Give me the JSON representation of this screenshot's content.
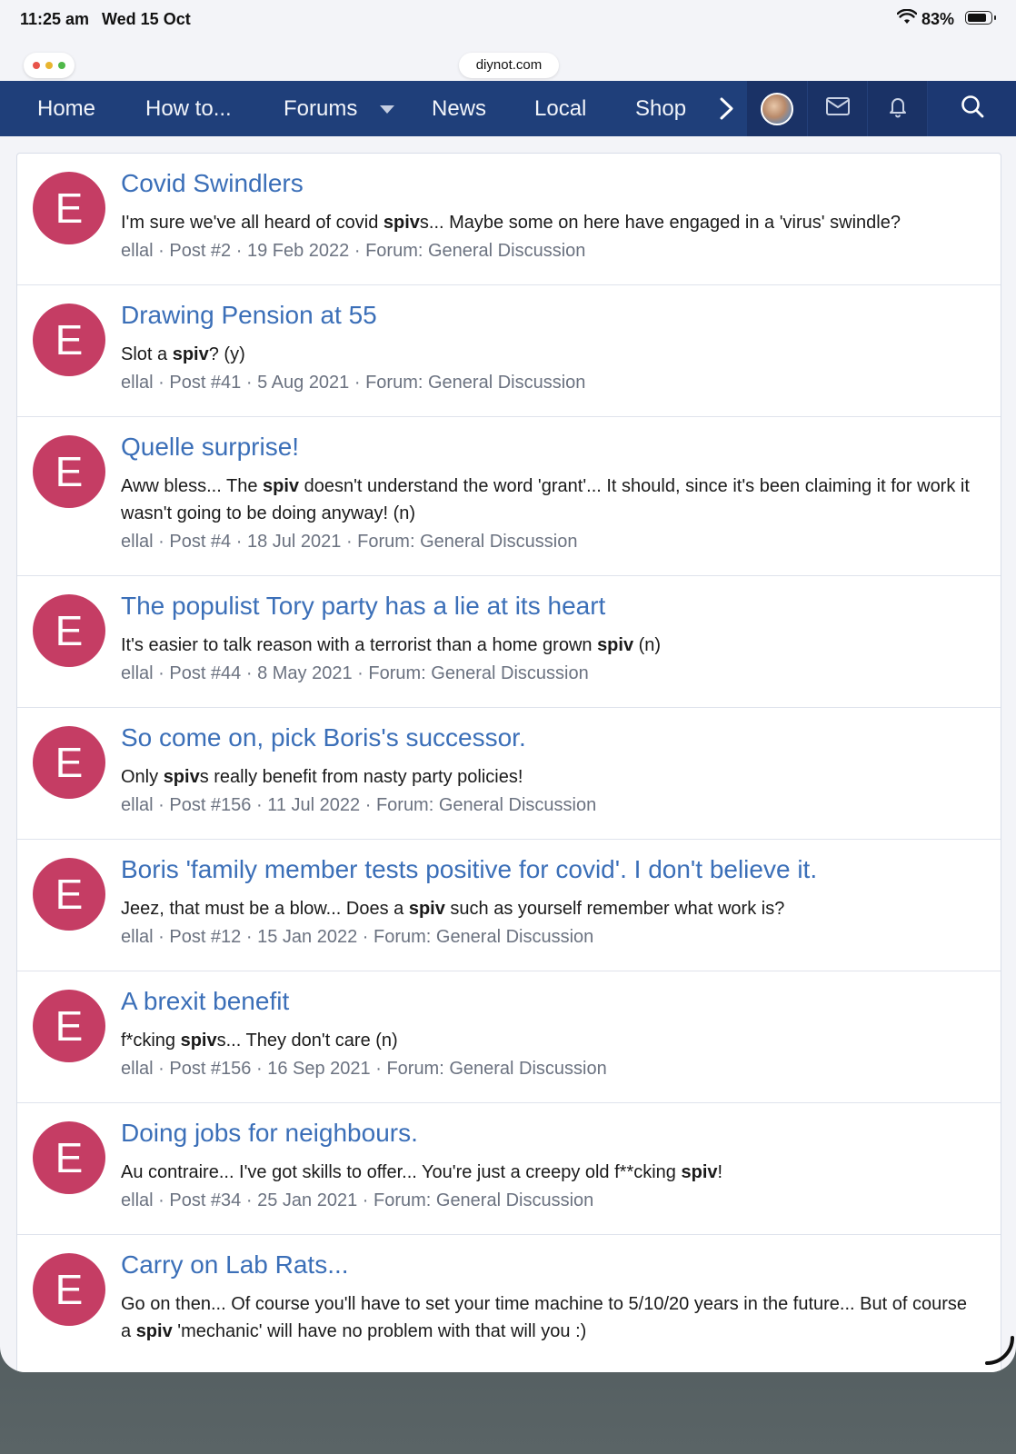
{
  "status": {
    "time": "11:25 am",
    "date": "Wed 15 Oct",
    "battery": "83%",
    "battery_level": 0.83
  },
  "browser": {
    "url": "diynot.com"
  },
  "nav": {
    "items": [
      "Home",
      "How to...",
      "Forums",
      "News",
      "Local",
      "Shop"
    ]
  },
  "results": [
    {
      "avatar_letter": "E",
      "title": "Covid Swindlers",
      "snippet_parts": [
        "I'm sure we've all heard of covid ",
        "spiv",
        "s... Maybe some on here have engaged in a 'virus' swindle?"
      ],
      "author": "ellal",
      "post": "Post #2",
      "date": "19 Feb 2022",
      "forum": "Forum: General Discussion"
    },
    {
      "avatar_letter": "E",
      "title": "Drawing Pension at 55",
      "snippet_parts": [
        "Slot a ",
        "spiv",
        "? (y)"
      ],
      "author": "ellal",
      "post": "Post #41",
      "date": "5 Aug 2021",
      "forum": "Forum: General Discussion"
    },
    {
      "avatar_letter": "E",
      "title": "Quelle surprise!",
      "snippet_parts": [
        "Aww bless... The ",
        "spiv",
        " doesn't understand the word 'grant'... It should, since it's been claiming it for work it wasn't going to be doing anyway! (n)"
      ],
      "author": "ellal",
      "post": "Post #4",
      "date": "18 Jul 2021",
      "forum": "Forum: General Discussion"
    },
    {
      "avatar_letter": "E",
      "title": "The populist Tory party has a lie at its heart",
      "snippet_parts": [
        "It's easier to talk reason with a terrorist than a home grown ",
        "spiv",
        " (n)"
      ],
      "author": "ellal",
      "post": "Post #44",
      "date": "8 May 2021",
      "forum": "Forum: General Discussion"
    },
    {
      "avatar_letter": "E",
      "title": "So come on, pick Boris's successor.",
      "snippet_parts": [
        "Only ",
        "spiv",
        "s really benefit from nasty party policies!"
      ],
      "author": "ellal",
      "post": "Post #156",
      "date": "11 Jul 2022",
      "forum": "Forum: General Discussion"
    },
    {
      "avatar_letter": "E",
      "title": "Boris 'family member tests positive for covid'. I don't believe it.",
      "snippet_parts": [
        "Jeez, that must be a blow... Does a ",
        "spiv",
        " such as yourself remember what work is?"
      ],
      "author": "ellal",
      "post": "Post #12",
      "date": "15 Jan 2022",
      "forum": "Forum: General Discussion"
    },
    {
      "avatar_letter": "E",
      "title": "A brexit benefit",
      "snippet_parts": [
        "f*cking ",
        "spiv",
        "s... They don't care (n)"
      ],
      "author": "ellal",
      "post": "Post #156",
      "date": "16 Sep 2021",
      "forum": "Forum: General Discussion"
    },
    {
      "avatar_letter": "E",
      "title": "Doing jobs for neighbours.",
      "snippet_parts": [
        "Au contraire... I've got skills to offer... You're just a creepy old f**cking ",
        "spiv",
        "!"
      ],
      "author": "ellal",
      "post": "Post #34",
      "date": "25 Jan 2021",
      "forum": "Forum: General Discussion"
    },
    {
      "avatar_letter": "E",
      "title": "Carry on Lab Rats...",
      "snippet_parts": [
        "Go on then... Of course you'll have to set your time machine to 5/10/20 years in the future... But of course a ",
        "spiv",
        " 'mechanic' will have no problem with that will you :)"
      ],
      "author": "",
      "post": "",
      "date": "",
      "forum": ""
    }
  ]
}
